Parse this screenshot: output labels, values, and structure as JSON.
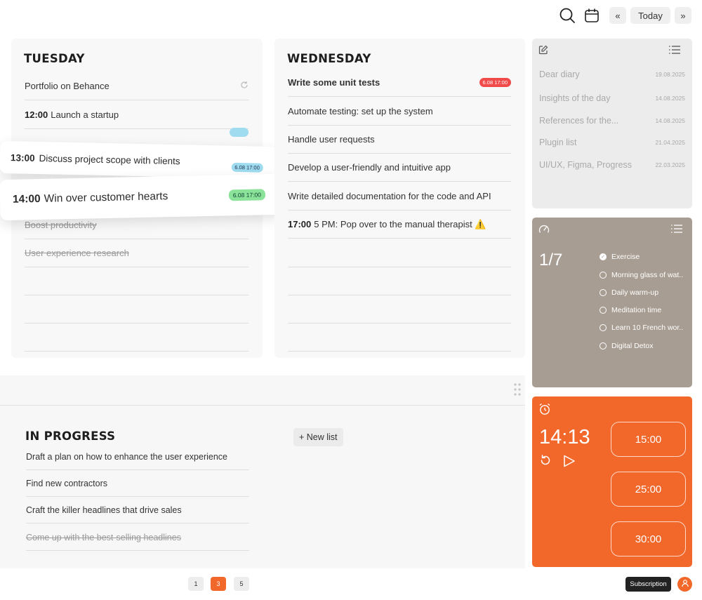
{
  "toolbar": {
    "search_icon": "search-icon",
    "calendar_icon": "calendar-icon",
    "prev_label": "«",
    "today_label": "Today",
    "next_label": "»"
  },
  "days": [
    {
      "title": "TUESDAY",
      "rows": [
        {
          "time": "",
          "text": "Portfolio on Behance",
          "done": false,
          "icon": "sync-icon"
        },
        {
          "time": "12:00",
          "text": "Launch a startup",
          "done": false
        },
        {
          "time": "",
          "text": "",
          "done": false
        },
        {
          "time": "",
          "text": "",
          "done": false
        },
        {
          "time": "",
          "text": "",
          "done": false
        },
        {
          "time": "",
          "text": "Boost productivity",
          "done": true
        },
        {
          "time": "",
          "text": "User experience research",
          "done": true
        },
        {
          "time": "",
          "text": "",
          "done": false
        },
        {
          "time": "",
          "text": "",
          "done": false
        },
        {
          "time": "",
          "text": "",
          "done": false
        }
      ],
      "floating": [
        {
          "time": "13:00",
          "text": "Discuss project scope with clients",
          "badge": "6.08 17:00"
        },
        {
          "time": "14:00",
          "text": "Win over customer hearts",
          "badge": "6.08 17:00"
        }
      ]
    },
    {
      "title": "WEDNESDAY",
      "rows": [
        {
          "time": "",
          "text": "Write some unit tests",
          "done": false,
          "bold": true,
          "badge": "6.08 17:00"
        },
        {
          "time": "",
          "text": "Automate testing: set up the system",
          "done": false
        },
        {
          "time": "",
          "text": "Handle user requests",
          "done": false
        },
        {
          "time": "",
          "text": "Develop a user-friendly and intuitive app",
          "done": false
        },
        {
          "time": "",
          "text": "Write detailed documentation for the code and API",
          "done": false
        },
        {
          "time": "17:00",
          "text": "5 PM: Pop over to the manual therapist ⚠️",
          "done": false
        },
        {
          "time": "",
          "text": "",
          "done": false
        },
        {
          "time": "",
          "text": "",
          "done": false
        },
        {
          "time": "",
          "text": "",
          "done": false
        },
        {
          "time": "",
          "text": "",
          "done": false
        }
      ]
    }
  ],
  "diary": {
    "edit_icon": "edit-icon",
    "list_icon": "list-icon",
    "entries": [
      {
        "title": "Dear diary",
        "date": "19.08.2025"
      },
      {
        "title": "Insights of the day",
        "date": "14.08.2025"
      },
      {
        "title": "References for the...",
        "date": "14.08.2025"
      },
      {
        "title": "Plugin list",
        "date": "21.04.2025"
      },
      {
        "title": "UI/UX, Figma, Progress",
        "date": "22.03.2025"
      }
    ]
  },
  "habits": {
    "gauge_icon": "gauge-icon",
    "list_icon": "list-icon",
    "progress": "1/7",
    "items": [
      {
        "label": "Exercise",
        "checked": true
      },
      {
        "label": "Morning glass of wat..",
        "checked": false
      },
      {
        "label": "Daily warm-up",
        "checked": false
      },
      {
        "label": "Meditation time",
        "checked": false
      },
      {
        "label": "Learn 10 French wor..",
        "checked": false
      },
      {
        "label": "Digital Detox",
        "checked": false
      }
    ]
  },
  "timer": {
    "alarm_icon": "alarm-icon",
    "time": "14:13",
    "presets": [
      "15:00",
      "25:00",
      "30:00"
    ]
  },
  "in_progress": {
    "title": "IN PROGRESS",
    "new_list_label": "+ New list",
    "rows": [
      {
        "text": "Draft a plan on how to enhance the user experience",
        "done": false
      },
      {
        "text": "Find new contractors",
        "done": false
      },
      {
        "text": "Craft the killer headlines that drive sales",
        "done": false
      },
      {
        "text": "Come up with the best-selling headlines",
        "done": true
      }
    ]
  },
  "pagination": {
    "pages": [
      "1",
      "3",
      "5"
    ],
    "active": "3"
  },
  "footer": {
    "subscription_label": "Subscription"
  },
  "colors": {
    "accent": "#f2672a",
    "habits_bg": "#a89d93",
    "diary_bg": "#ececec"
  }
}
